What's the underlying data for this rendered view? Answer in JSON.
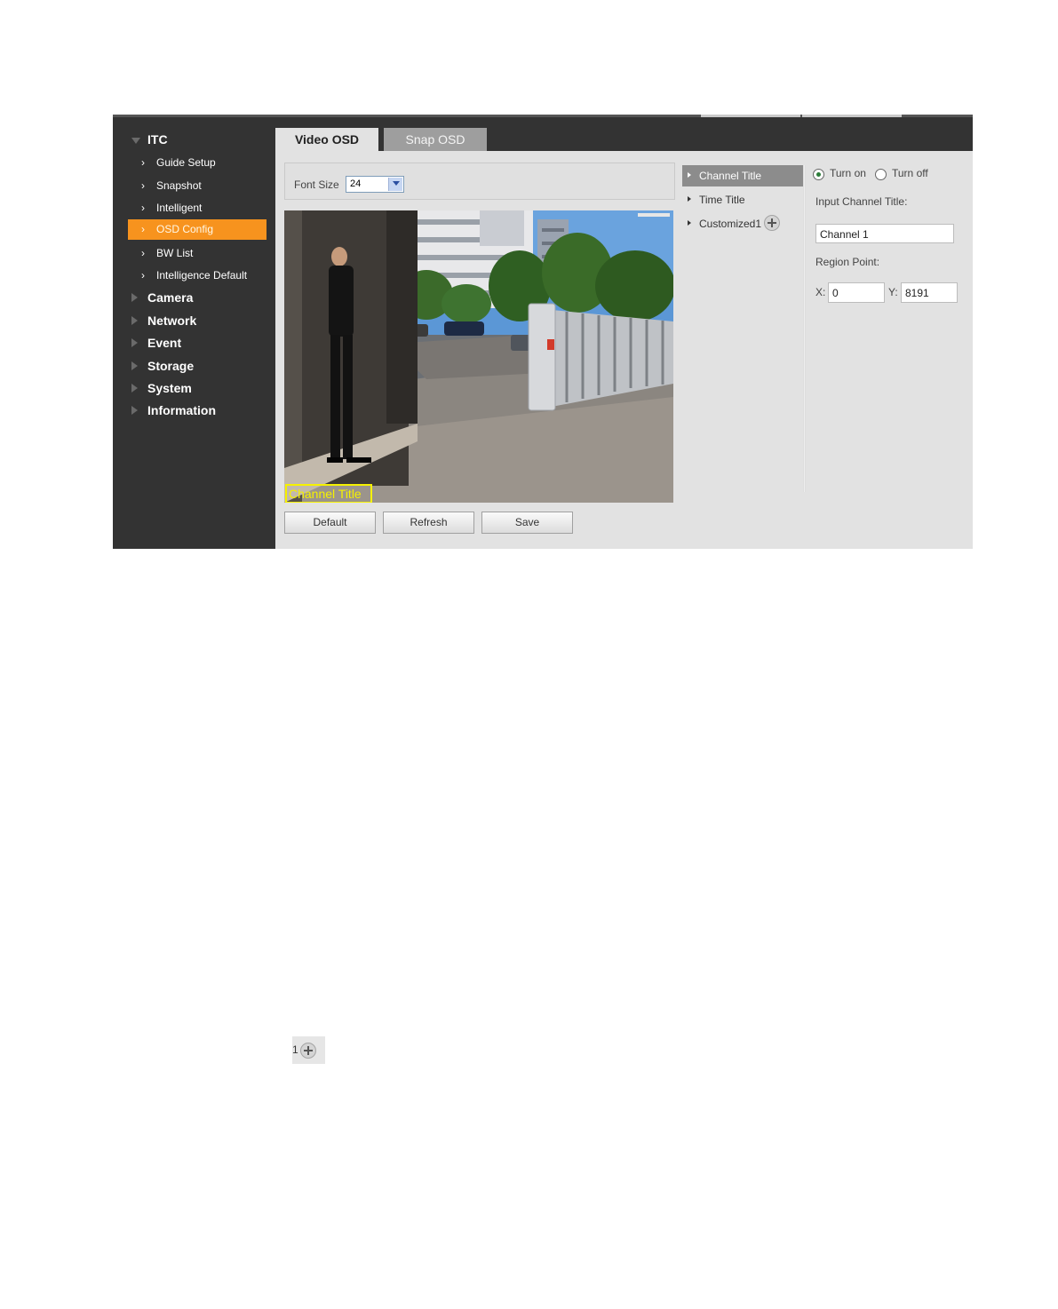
{
  "sidebar": {
    "root": {
      "label": "ITC",
      "icon": "triangle-down-icon"
    },
    "items": [
      {
        "label": "Guide Setup"
      },
      {
        "label": "Snapshot"
      },
      {
        "label": "Intelligent"
      },
      {
        "label": "OSD Config",
        "active": true
      },
      {
        "label": "BW List"
      },
      {
        "label": "Intelligence Default"
      }
    ],
    "groups": [
      {
        "label": "Camera"
      },
      {
        "label": "Network"
      },
      {
        "label": "Event"
      },
      {
        "label": "Storage"
      },
      {
        "label": "System"
      },
      {
        "label": "Information"
      }
    ]
  },
  "tabs": [
    {
      "label": "Video OSD",
      "active": true
    },
    {
      "label": "Snap OSD",
      "active": false
    }
  ],
  "font_size": {
    "label": "Font Size",
    "value": "24"
  },
  "preview": {
    "osd_overlay_text": "Channel Title"
  },
  "buttons": {
    "default": "Default",
    "refresh": "Refresh",
    "save": "Save"
  },
  "osd_list": {
    "items": [
      {
        "label": "Channel Title",
        "active": true
      },
      {
        "label": "Time Title"
      },
      {
        "label": "Customized1",
        "has_add": true
      }
    ]
  },
  "config": {
    "turn_on": "Turn on",
    "turn_off": "Turn off",
    "selected": "Turn on",
    "input_label": "Input Channel Title:",
    "input_value": "Channel 1",
    "region_label": "Region Point:",
    "x_label": "X:",
    "x_value": "0",
    "y_label": "Y:",
    "y_value": "8191"
  },
  "stray_icon": {
    "text": "1"
  },
  "colors": {
    "sidebar_bg": "#333333",
    "active_accent": "#f7931e",
    "osd_overlay": "#f5f100",
    "radio_selected": "#2d7d3a"
  }
}
